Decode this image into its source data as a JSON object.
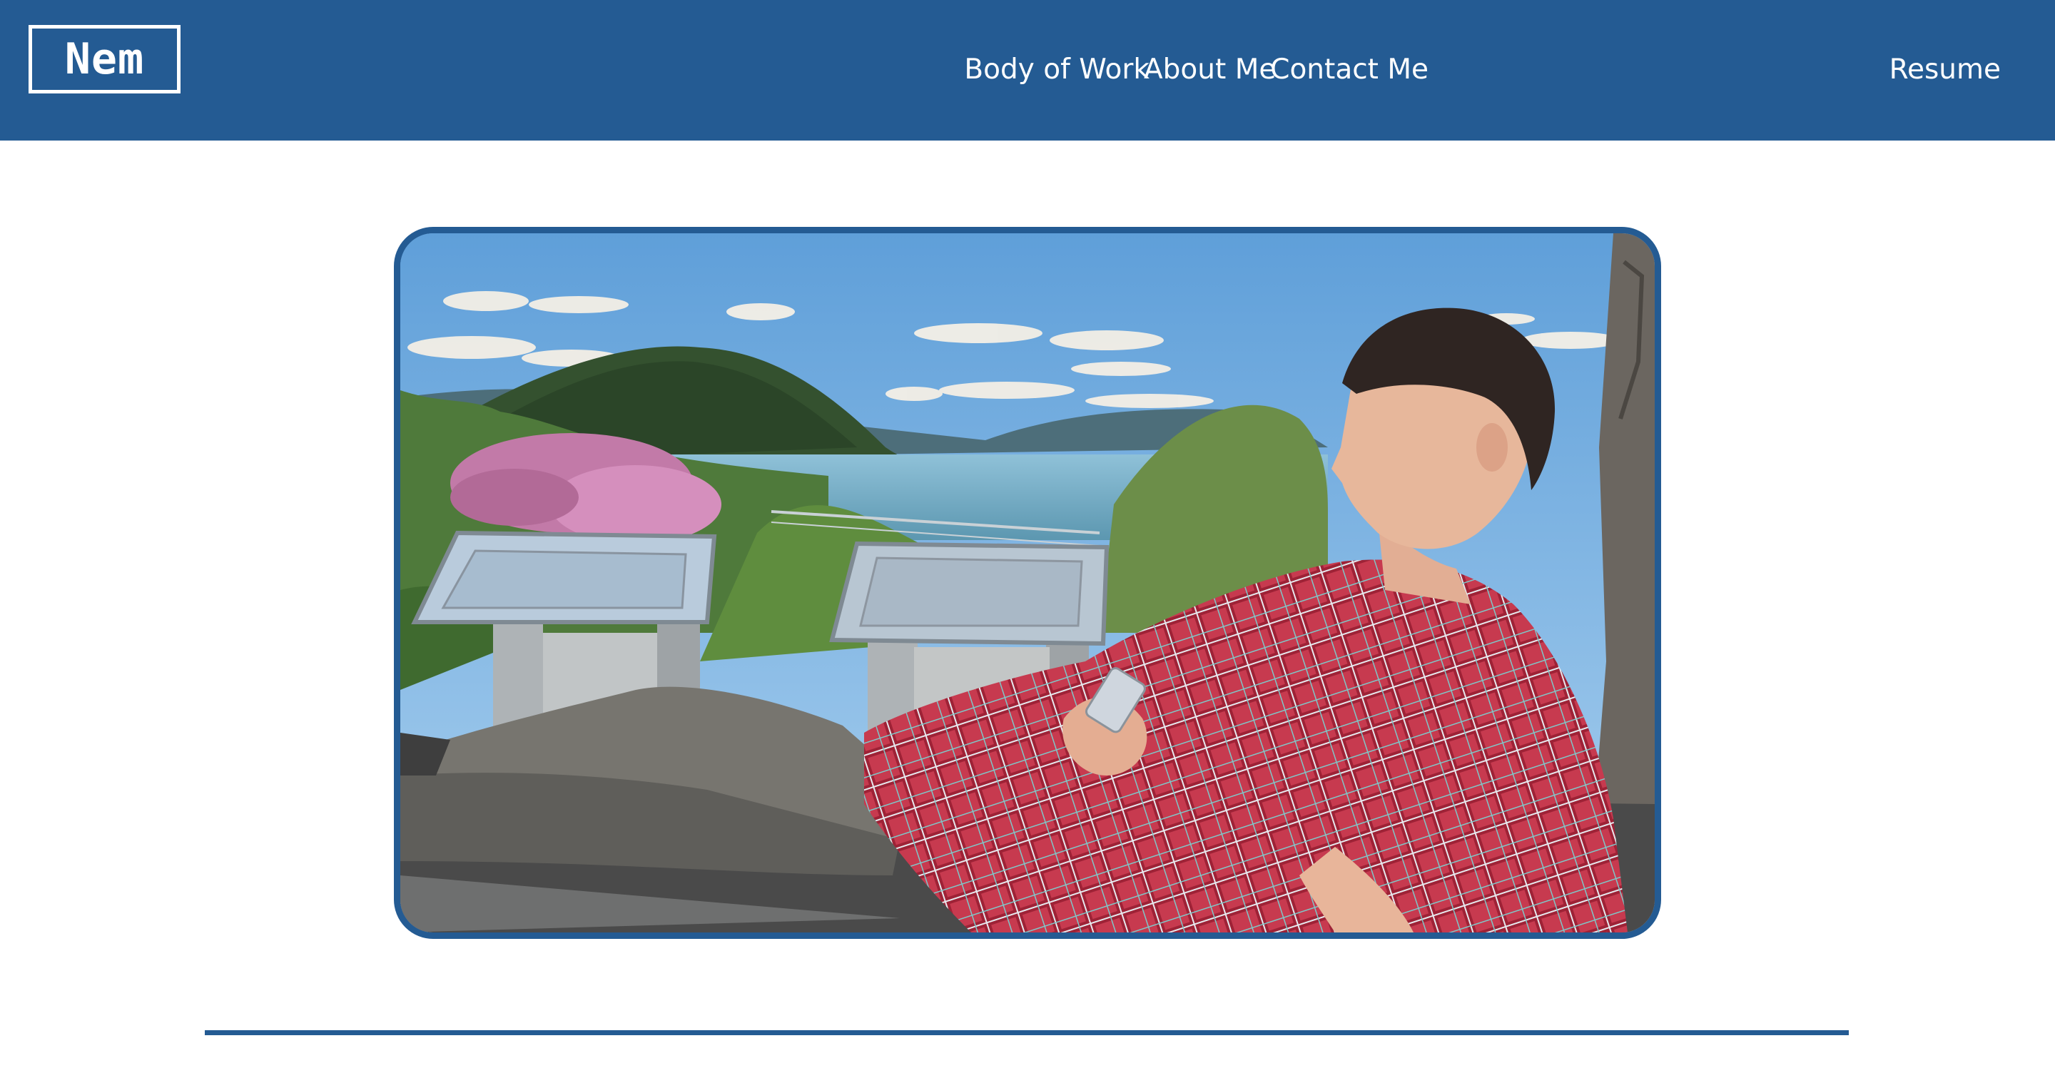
{
  "brand": {
    "logo_text": "Nem",
    "primary_color": "#245b93",
    "text_color": "#ffffff"
  },
  "nav": {
    "items": [
      {
        "label": "About Me"
      },
      {
        "label": "Body of Work"
      },
      {
        "label": "Contact Me"
      },
      {
        "label": "Resume"
      }
    ]
  },
  "hero": {
    "image_alt": "Man in a red plaid shirt reclining on a stone ledge overlooking a lake and forested hills"
  }
}
